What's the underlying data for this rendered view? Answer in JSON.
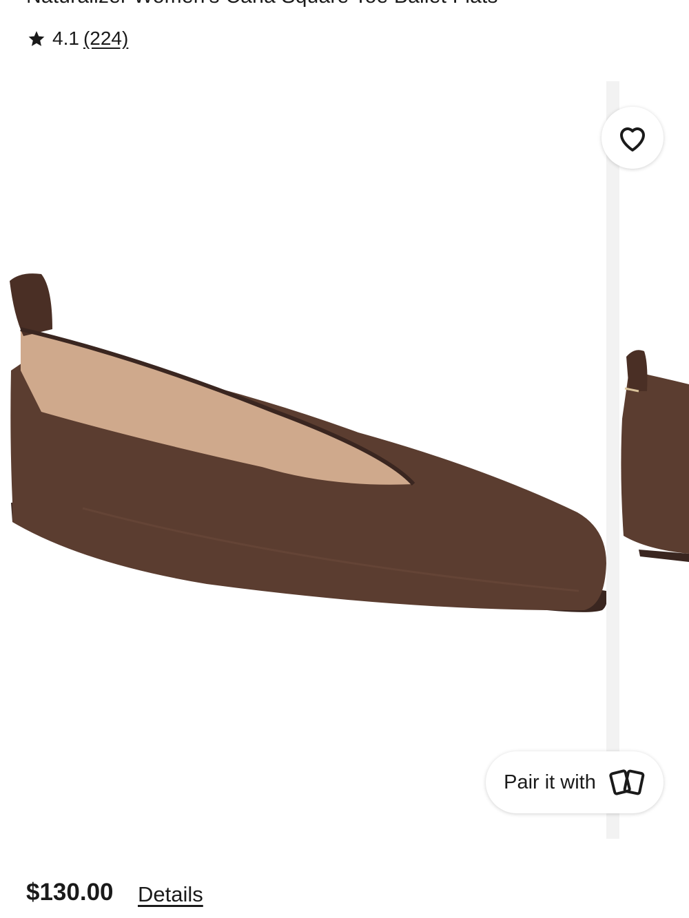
{
  "product": {
    "title": "Naturalizer Women's Carla Square Toe Ballet Flats",
    "rating": "4.1",
    "review_count": "(224)",
    "price": "$130.00",
    "details_link": "Details"
  },
  "actions": {
    "favorite_icon": "heart-icon",
    "pair_label": "Pair it with",
    "pair_icon": "cards-icon"
  },
  "colors": {
    "shoe_brown": "#5a3b2e",
    "lining": "#cfa98c",
    "text": "#1a1a1a"
  }
}
